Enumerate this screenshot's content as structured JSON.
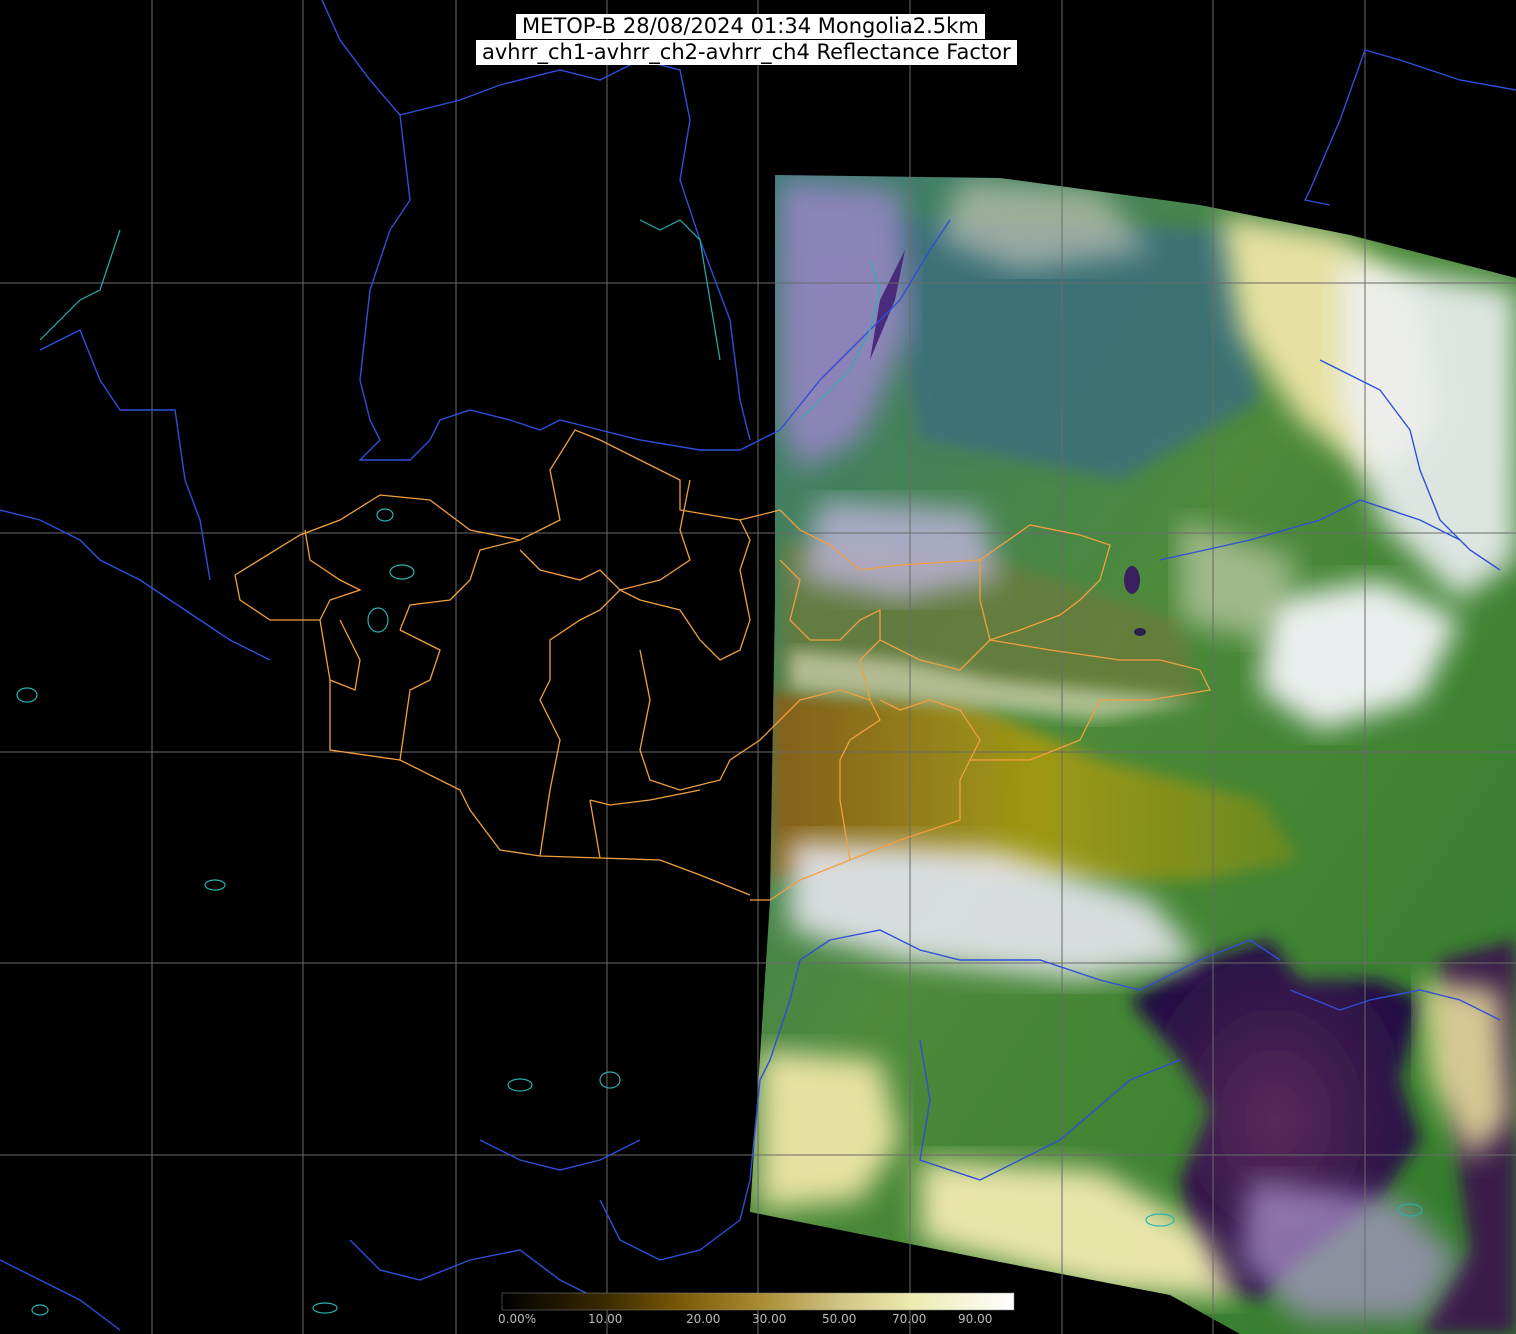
{
  "header": {
    "line1": "METOP-B 28/08/2024 01:34 Mongolia2.5km",
    "line2": "avhrr_ch1-avhrr_ch2-avhrr_ch4 Reflectance Factor"
  },
  "legend": {
    "labels": [
      "0.00%",
      "10.00",
      "20.00",
      "30.00",
      "50.00",
      "70.00",
      "90.00"
    ],
    "colors": [
      "#000000",
      "#3a2a00",
      "#6b4a05",
      "#9a7a10",
      "#c8b060",
      "#e8e0a0",
      "#f4f4c8",
      "#ffffff"
    ]
  },
  "map": {
    "colors": {
      "background": "#000000",
      "graticule": "#6a6a6a",
      "country_border": "#2f4fd8",
      "province_border": "#f0a040",
      "water": "#2ab0b0"
    }
  }
}
